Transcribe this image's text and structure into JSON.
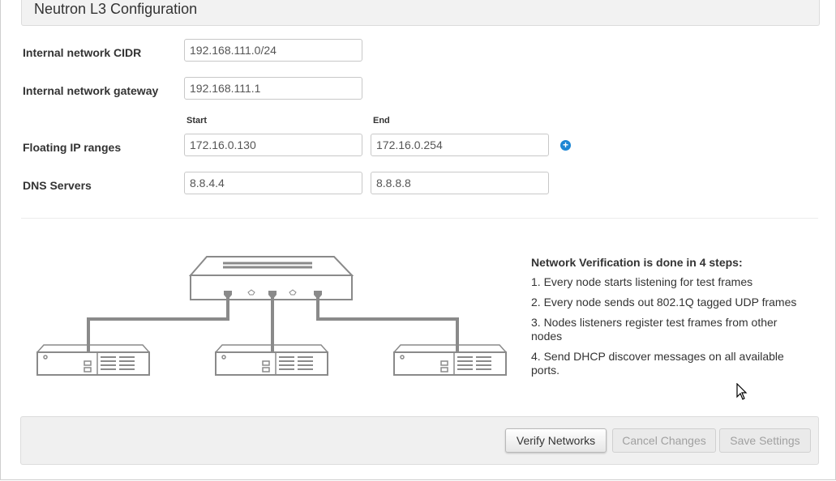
{
  "section": {
    "title": "Neutron L3 Configuration"
  },
  "fields": {
    "internal_cidr": {
      "label": "Internal network CIDR",
      "value": "192.168.111.0/24"
    },
    "internal_gateway": {
      "label": "Internal network gateway",
      "value": "192.168.111.1"
    },
    "floating_ip": {
      "label": "Floating IP ranges",
      "start_label": "Start",
      "end_label": "End",
      "start_value": "172.16.0.130",
      "end_value": "172.16.0.254",
      "add_icon": "plus-circle-icon"
    },
    "dns": {
      "label": "DNS Servers",
      "values": [
        "8.8.4.4",
        "8.8.8.8"
      ]
    }
  },
  "verification": {
    "title": "Network Verification is done in 4 steps:",
    "steps": [
      "1. Every node starts listening for test frames",
      "2. Every node sends out 802.1Q tagged UDP frames",
      "3. Nodes listeners register test frames from other nodes",
      "4. Send DHCP discover messages on all available ports."
    ]
  },
  "buttons": {
    "verify": "Verify Networks",
    "cancel": "Cancel Changes",
    "save": "Save Settings"
  },
  "colors": {
    "accent": "#1e87d4",
    "panel": "#f0f0f0",
    "diagram_stroke": "#8a8a8a"
  }
}
